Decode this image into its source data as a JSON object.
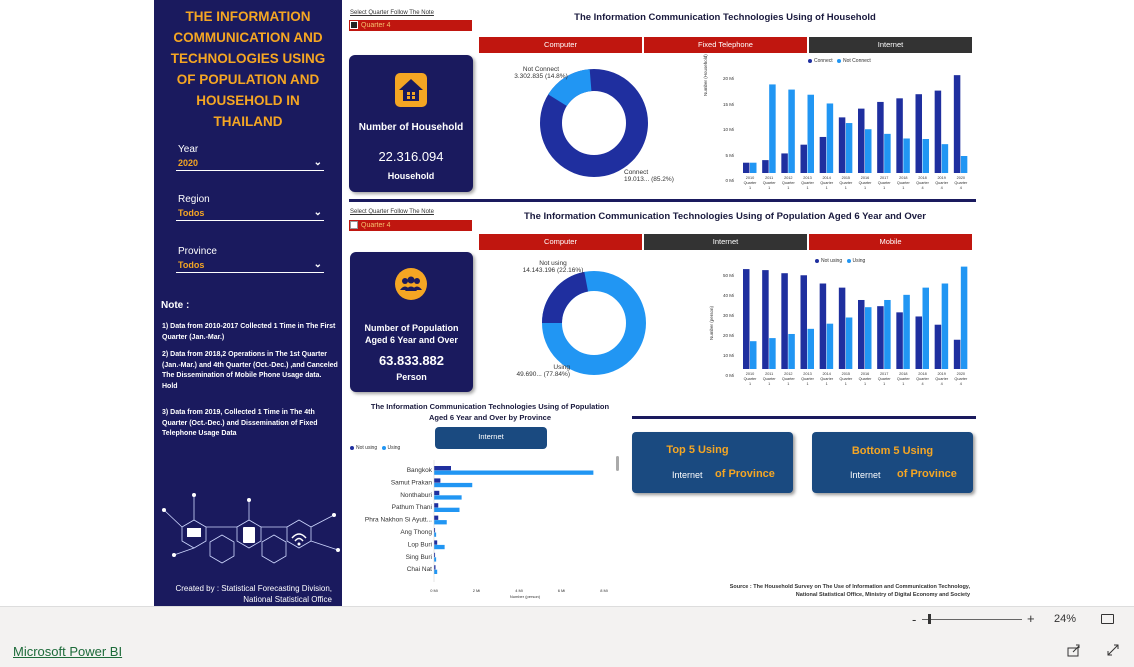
{
  "sidebar": {
    "title_lines": [
      "THE INFORMATION",
      "COMMUNICATION AND",
      "TECHNOLOGIES USING",
      "OF POPULATION AND",
      "HOUSEHOLD IN",
      "THAILAND"
    ],
    "year_label": "Year",
    "year_value": "2020",
    "region_label": "Region",
    "region_value": "Todos",
    "province_label": "Province",
    "province_value": "Todos",
    "note_title": "Note :",
    "notes": [
      "1) Data from 2010-2017 Collected 1 Time in The First Quarter (Jan.-Mar.)",
      "2) Data from 2018,2 Operations in The 1st Quarter (Jan.-Mar.) and 4th Quarter (Oct.-Dec.) ,and Canceled The Dissemination of Mobile Phone Usage data. Hold",
      "3) Data from 2019, Collected 1 Time in The 4th Quarter (Oct.-Dec.) and Dissemination of Fixed Telephone Usage Data"
    ],
    "credit_line1": "Created by : Statistical Forecasting Division,",
    "credit_line2": "National Statistical Office"
  },
  "household": {
    "quarter_label": "Select Quarter Follow The Note",
    "quarter_value": "Quarter 4",
    "title": "The Information Communication Technologies Using of Household",
    "tabs": [
      "Computer",
      "Fixed Telephone",
      "Internet"
    ],
    "card_label": "Number of Household",
    "card_value": "22.316.094",
    "card_unit": "Household",
    "donut_top_label": "Not Connect",
    "donut_top_value": "3.302.835 (14.8%)",
    "donut_bottom_label": "Connect",
    "donut_bottom_value": "19.013... (85.2%)",
    "legend": [
      "Connect",
      "Not Connect"
    ],
    "y_axis_label": "Number (Household)",
    "y_ticks": [
      "20 Mi",
      "15 Mi",
      "10 Mi",
      "5 Mi",
      "0 Mi"
    ]
  },
  "population": {
    "quarter_label": "Select Quarter Follow The Note",
    "quarter_value": "Quarter 4",
    "title": "The Information Communication Technologies Using of Population Aged 6 Year and Over",
    "tabs": [
      "Computer",
      "Internet",
      "Mobile"
    ],
    "card_label_line1": "Number of Population",
    "card_label_line2": "Aged 6 Year and Over",
    "card_value": "63.833.882",
    "card_unit": "Person",
    "donut_top_label": "Not using",
    "donut_top_value": "14.143.196 (22.16%)",
    "donut_bottom_label": "Using",
    "donut_bottom_value": "49.690... (77.84%)",
    "legend": [
      "Not using",
      "Using"
    ],
    "y_axis_label": "Number (person)",
    "y_ticks": [
      "50 Mi",
      "40 Mi",
      "30 Mi",
      "20 Mi",
      "10 Mi",
      "0 Mi"
    ]
  },
  "province": {
    "title_line1": "The Information Communication Technologies Using of Population",
    "title_line2": "Aged 6 Year and Over by Province",
    "button": "Internet",
    "legend": [
      "Not using",
      "Using"
    ],
    "x_ticks": [
      "0 Mi",
      "2 Mi",
      "4 Mi",
      "6 Mi",
      "8 Mi"
    ],
    "x_label": "Number (person)"
  },
  "top5": {
    "title": "Top 5 Using",
    "sub_left": "Internet",
    "sub_right": "of Province"
  },
  "bottom5": {
    "title": "Bottom 5 Using",
    "sub_left": "Internet",
    "sub_right": "of Province"
  },
  "source_line1": "Source : The Household Survey on The Use of Information and Communication Technology,",
  "source_line2": "National Statistical Office, Ministry of Digital Economy and Society",
  "footer": {
    "zoom": "24%",
    "brand": "Microsoft Power BI"
  },
  "colors": {
    "navy": "#1a1a5e",
    "dark_blue": "#1f2f9f",
    "light_blue": "#2196f3",
    "red": "#c0160f",
    "orange": "#f5a623"
  },
  "chart_data": [
    {
      "type": "pie",
      "title": "",
      "labels": [
        "Connect",
        "Not Connect"
      ],
      "values": [
        85.2,
        14.8
      ]
    },
    {
      "type": "bar",
      "title": "",
      "categories": [
        "2010 Quarter 1",
        "2011 Quarter 1",
        "2012 Quarter 1",
        "2013 Quarter 1",
        "2014 Quarter 1",
        "2015 Quarter 1",
        "2016 Quarter 1",
        "2017 Quarter 1",
        "2018 Quarter 1",
        "2018 Quarter 4",
        "2019 Quarter 4",
        "2020 Quarter 4"
      ],
      "series": [
        {
          "name": "Connect",
          "values": [
            2.0,
            2.5,
            3.8,
            5.5,
            7.0,
            10.8,
            12.5,
            13.8,
            14.5,
            15.3,
            16.0,
            19.0
          ]
        },
        {
          "name": "Not Connect",
          "values": [
            2.0,
            17.2,
            16.2,
            15.2,
            13.5,
            9.7,
            8.5,
            7.6,
            6.7,
            6.6,
            5.6,
            3.3
          ]
        }
      ],
      "ylabel": "Number (Household)",
      "ylim": [
        0,
        20
      ]
    },
    {
      "type": "pie",
      "title": "",
      "labels": [
        "Not using",
        "Using"
      ],
      "values": [
        22.16,
        77.84
      ]
    },
    {
      "type": "bar",
      "title": "",
      "categories": [
        "2010 Quarter 1",
        "2011 Quarter 1",
        "2012 Quarter 1",
        "2013 Quarter 1",
        "2014 Quarter 1",
        "2015 Quarter 1",
        "2016 Quarter 1",
        "2017 Quarter 1",
        "2018 Quarter 1",
        "2018 Quarter 4",
        "2019 Quarter 4",
        "2020 Quarter 4"
      ],
      "series": [
        {
          "name": "Not using",
          "values": [
            48.5,
            48.0,
            46.5,
            45.5,
            41.5,
            39.5,
            33.5,
            30.5,
            27.5,
            25.5,
            21.5,
            14.2
          ]
        },
        {
          "name": "Using",
          "values": [
            13.5,
            15.0,
            17.0,
            19.5,
            22.0,
            25.0,
            30.0,
            33.5,
            36.0,
            39.5,
            41.5,
            49.7
          ]
        }
      ],
      "ylabel": "Number (person)",
      "ylim": [
        0,
        50
      ]
    },
    {
      "type": "bar",
      "title": "The Information Communication Technologies Using of Population Aged 6 Year and Over by Province",
      "categories": [
        "Bangkok",
        "Samut Prakan",
        "Nonthaburi",
        "Pathum Thani",
        "Phra Nakhon Si Ayutt...",
        "Ang Thong",
        "Lop Buri",
        "Sing Buri",
        "Chai Nat"
      ],
      "series": [
        {
          "name": "Not using",
          "values": [
            0.8,
            0.3,
            0.25,
            0.2,
            0.2,
            0.05,
            0.15,
            0.05,
            0.07
          ]
        },
        {
          "name": "Using",
          "values": [
            7.5,
            1.8,
            1.3,
            1.2,
            0.6,
            0.1,
            0.5,
            0.1,
            0.15
          ]
        }
      ],
      "xlabel": "Number (person)",
      "xlim": [
        0,
        8
      ]
    }
  ]
}
